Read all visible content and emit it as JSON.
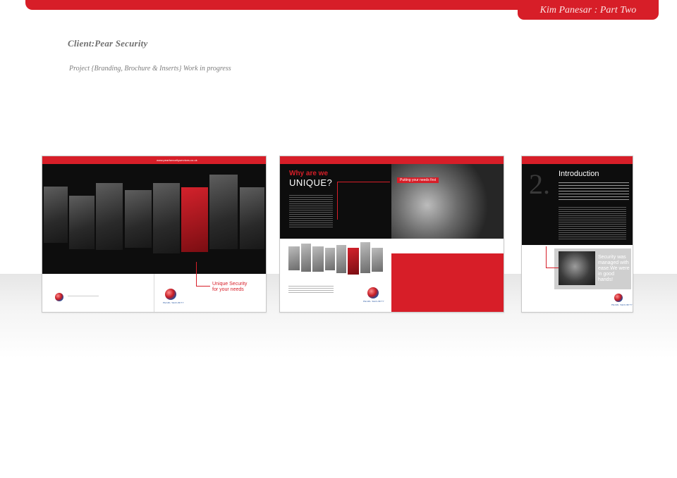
{
  "header": {
    "title": "Kim Panesar : Part Two"
  },
  "intro": {
    "client": "Client:Pear Security",
    "project": "Project {Branding, Brochure & Inserts} Work in progress"
  },
  "spread1": {
    "url": "www.pearlsecurityservices.co.uk",
    "tagline_line1": "Unique Security",
    "tagline_line2": "for your needs",
    "logo_text": "PEARL SECURITY"
  },
  "spread2": {
    "heading_line1": "Why are we",
    "heading_line2": "UNIQUE?",
    "callout": "Putting your needs first",
    "logo_text": "PEARL SECURITY"
  },
  "spread3": {
    "number": "2.",
    "title": "Introduction",
    "quote": "Security was managed with ease.We were in good hands!",
    "logo_text": "PEARL SECURITY"
  },
  "colors": {
    "brand_red": "#d71e28",
    "dark": "#0d0d0d"
  }
}
